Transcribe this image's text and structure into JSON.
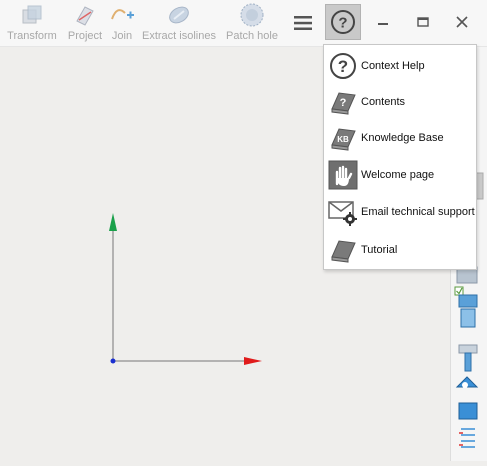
{
  "toolbar": {
    "tools": [
      {
        "label": "Transform",
        "icon": "transform-icon"
      },
      {
        "label": "Project",
        "icon": "project-icon"
      },
      {
        "label": "Join",
        "icon": "join-icon"
      },
      {
        "label": "Extract isolines",
        "icon": "extract-isolines-icon"
      },
      {
        "label": "Patch hole",
        "icon": "patch-hole-icon"
      }
    ],
    "menu_icon": "hamburger-menu-icon",
    "help_icon": "help-icon"
  },
  "window": {
    "minimize_icon": "minimize-icon",
    "restore_icon": "restore-icon",
    "close_icon": "close-icon"
  },
  "help_menu": {
    "items": [
      {
        "label": "Context Help",
        "icon": "help-circle-icon"
      },
      {
        "label": "Contents",
        "icon": "contents-book-icon"
      },
      {
        "label": "Knowledge Base",
        "icon": "knowledge-base-icon"
      },
      {
        "label": "Welcome page",
        "icon": "welcome-hand-icon"
      },
      {
        "label": "Email technical support",
        "icon": "email-support-icon"
      },
      {
        "label": "Tutorial",
        "icon": "tutorial-book-icon"
      }
    ]
  },
  "colors": {
    "axis_x": "#e01b1b",
    "axis_y": "#1aa04a",
    "axis_origin": "#1a2fd0",
    "accent_blue": "#3a8fd6"
  }
}
